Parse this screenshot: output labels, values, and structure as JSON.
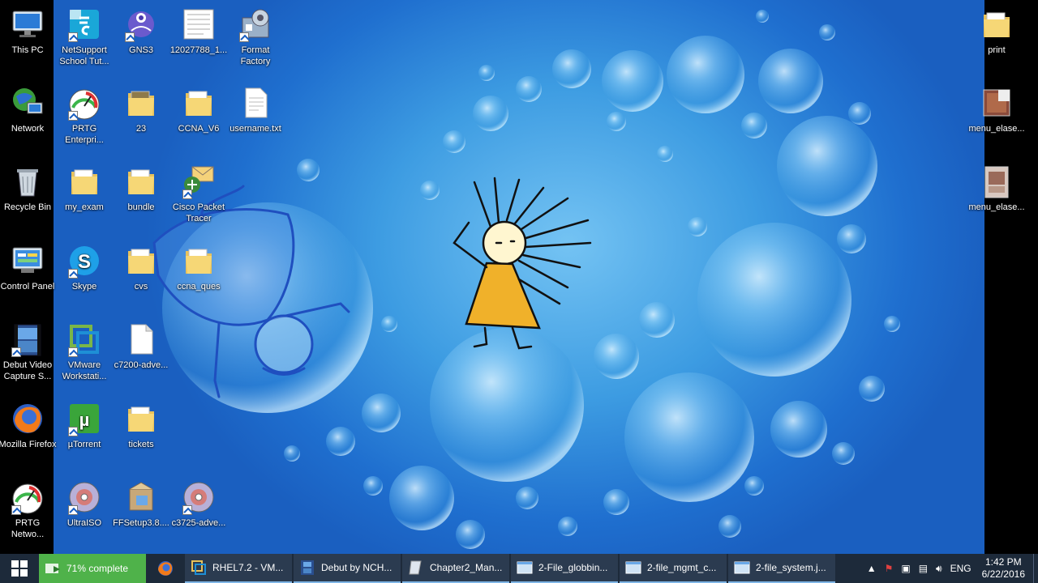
{
  "desktop": {
    "icons_col1": [
      {
        "label": "This PC",
        "icon": "computer-icon"
      },
      {
        "label": "Network",
        "icon": "network-icon"
      },
      {
        "label": "Recycle Bin",
        "icon": "recycle-bin-icon"
      },
      {
        "label": "Control Panel",
        "icon": "control-panel-icon"
      },
      {
        "label": "Debut Video Capture S...",
        "icon": "video-capture-icon"
      },
      {
        "label": "Mozilla Firefox",
        "icon": "firefox-icon"
      },
      {
        "label": "PRTG Netwo...",
        "icon": "gauge-icon"
      }
    ],
    "icons_col2": [
      {
        "label": "NetSupport School Tut...",
        "icon": "netsupport-icon"
      },
      {
        "label": "PRTG Enterpri...",
        "icon": "gauge-icon"
      },
      {
        "label": "my_exam",
        "icon": "folder-icon"
      },
      {
        "label": "Skype",
        "icon": "skype-icon"
      },
      {
        "label": "VMware Workstati...",
        "icon": "vmware-icon"
      },
      {
        "label": "µTorrent",
        "icon": "utorrent-icon"
      },
      {
        "label": "UltraISO",
        "icon": "disc-icon"
      }
    ],
    "icons_col3": [
      {
        "label": "GNS3",
        "icon": "gns3-icon"
      },
      {
        "label": "23",
        "icon": "folder-icon"
      },
      {
        "label": "bundle",
        "icon": "folder-icon"
      },
      {
        "label": "cvs",
        "icon": "folder-icon"
      },
      {
        "label": "c7200-adve...",
        "icon": "file-icon"
      },
      {
        "label": "tickets",
        "icon": "folder-icon"
      },
      {
        "label": "FFSetup3.8....",
        "icon": "installer-icon"
      }
    ],
    "icons_col4": [
      {
        "label": "12027788_1...",
        "icon": "document-icon"
      },
      {
        "label": "CCNA_V6",
        "icon": "folder-icon"
      },
      {
        "label": "Cisco Packet Tracer",
        "icon": "packet-tracer-icon"
      },
      {
        "label": "ccna_ques",
        "icon": "folder-icon"
      },
      {
        "label": "c3725-adve...",
        "icon": "disc-icon"
      }
    ],
    "icons_col5": [
      {
        "label": "Format Factory",
        "icon": "format-factory-icon"
      },
      {
        "label": "username.txt",
        "icon": "text-file-icon"
      }
    ],
    "icons_right": [
      {
        "label": "print",
        "icon": "folder-icon"
      },
      {
        "label": "menu_elase...",
        "icon": "image-file-icon"
      },
      {
        "label": "menu_elase...",
        "icon": "image-file-icon"
      }
    ]
  },
  "taskbar": {
    "progress_label": "71% complete",
    "progress_value": 0.71,
    "items": [
      {
        "label": "RHEL7.2 - VM...",
        "icon": "vmware-icon"
      },
      {
        "label": "Debut by NCH...",
        "icon": "video-capture-icon"
      },
      {
        "label": "Chapter2_Man...",
        "icon": "document-icon"
      },
      {
        "label": "2-File_globbin...",
        "icon": "window-icon"
      },
      {
        "label": "2-file_mgmt_c...",
        "icon": "window-icon"
      },
      {
        "label": "2-file_system.j...",
        "icon": "window-icon"
      }
    ],
    "language": "ENG",
    "time": "1:42 PM",
    "date": "6/22/2016"
  },
  "colors": {
    "taskbar": "#1d2a3a",
    "progress": "#4fb24a",
    "desktop_blue": "#3d9ce2"
  }
}
